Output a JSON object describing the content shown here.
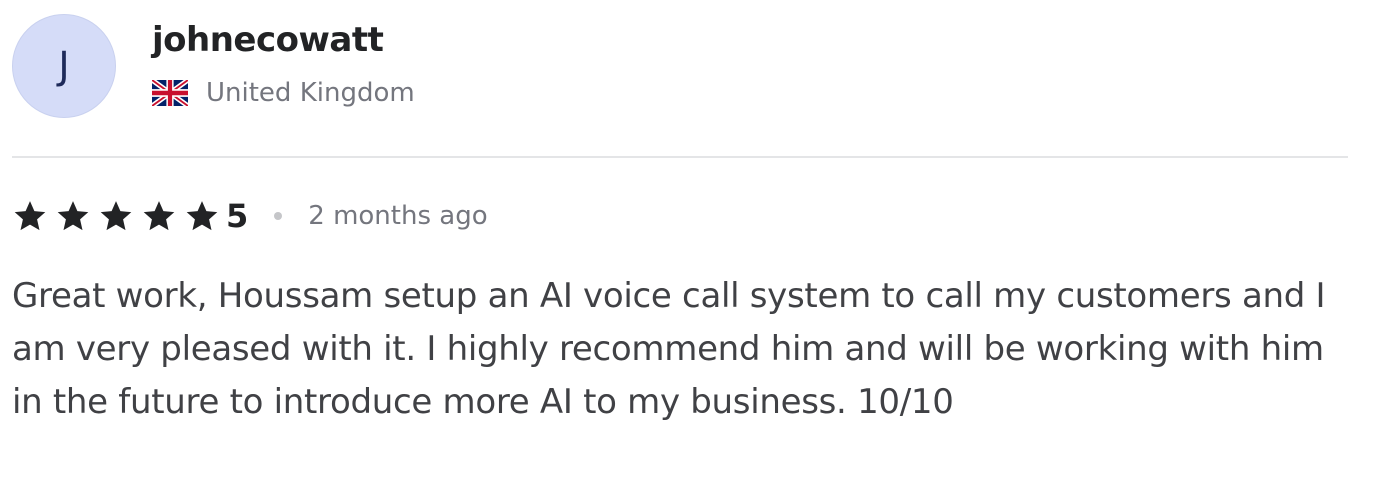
{
  "reviewer": {
    "avatar_initial": "J",
    "avatar_bg": "#d5dcf8",
    "username": "johnecowatt",
    "country": "United Kingdom",
    "country_flag_icon": "uk-flag-icon"
  },
  "review": {
    "rating_stars": 5,
    "rating_max": 5,
    "rating_value": "5",
    "star_icon": "star-icon",
    "star_color": "#222325",
    "time_ago": "2 months ago",
    "text": "Great work, Houssam setup an AI voice call system to call my customers and I am very pleased with it. I highly recommend him and will be working with him in the future to introduce more AI to my business. 10/10"
  }
}
